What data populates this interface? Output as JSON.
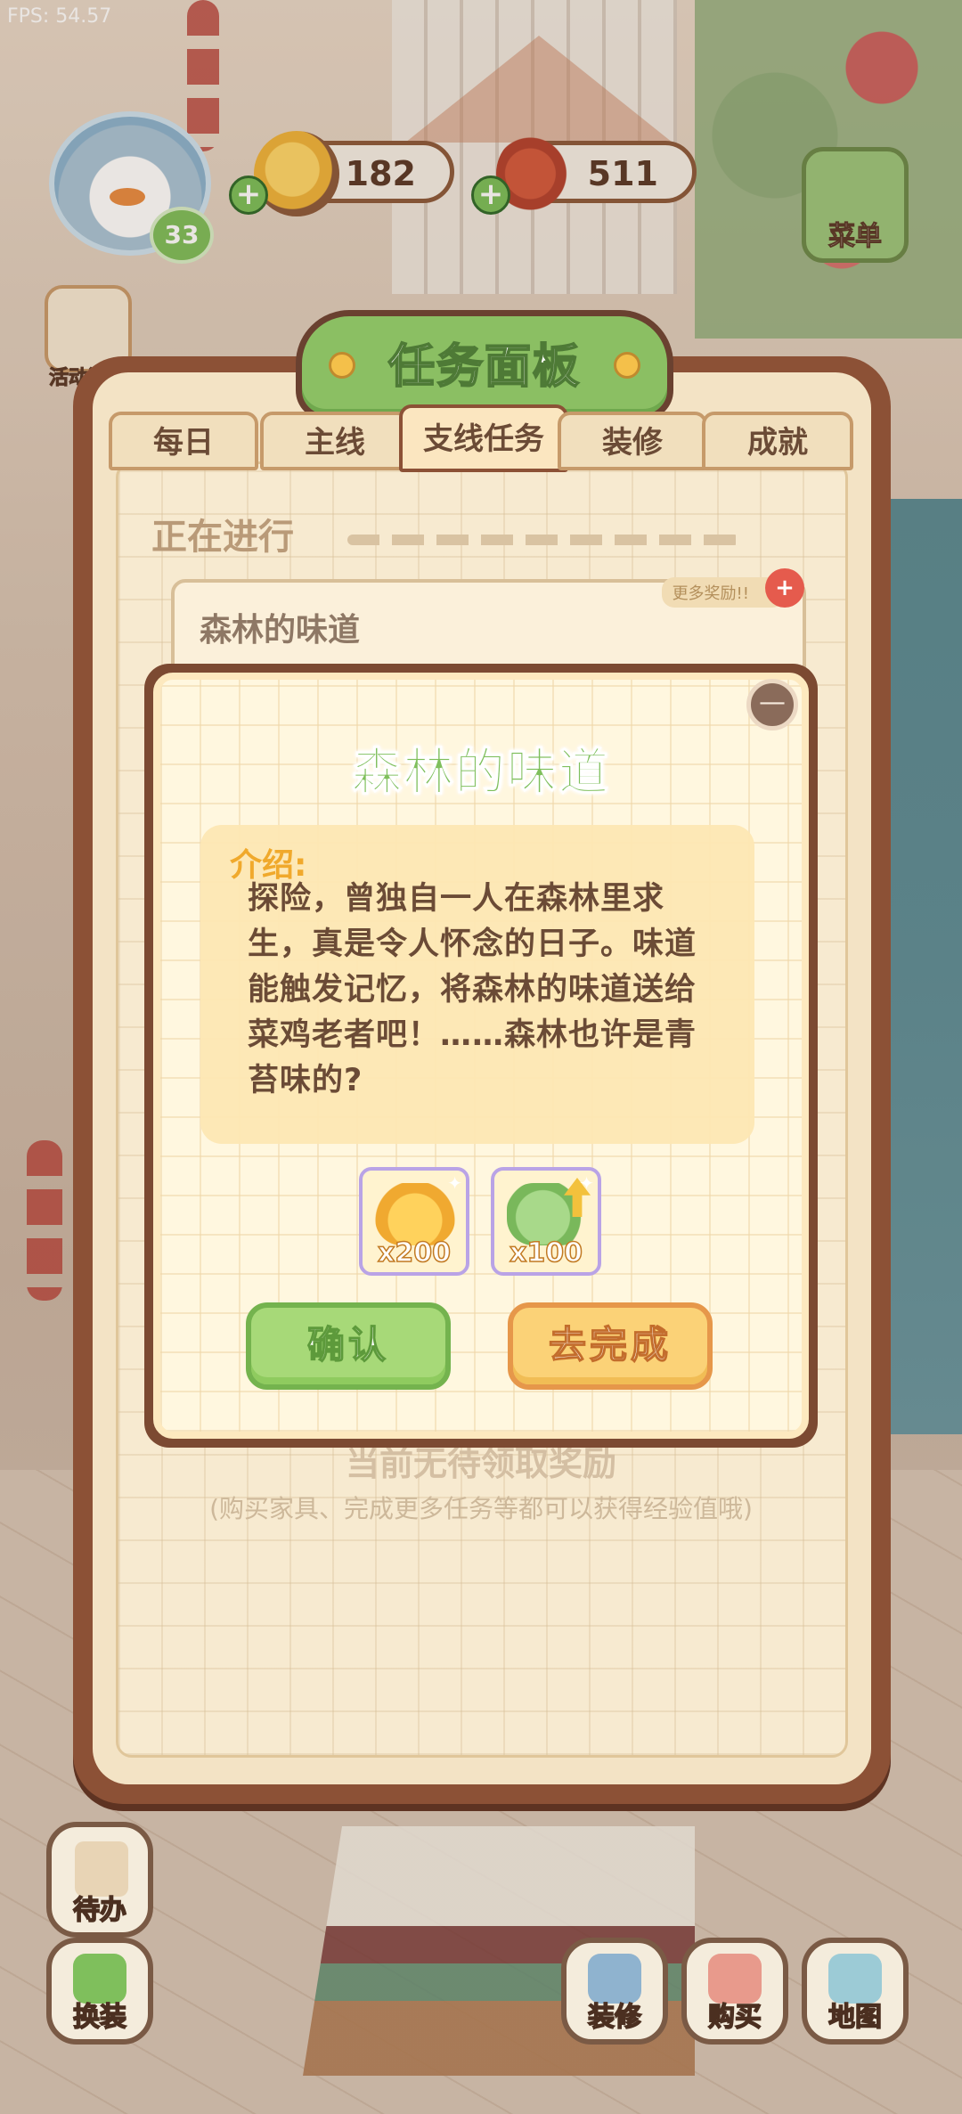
{
  "hud": {
    "fps": "FPS: 54.57",
    "level": "33",
    "coins": "182",
    "food": "511",
    "menu_label": "菜单",
    "left_buttons": [
      "活动汇总"
    ]
  },
  "panel": {
    "title": "任务面板",
    "tabs": [
      "每日",
      "主线",
      "支线任务",
      "装修",
      "成就"
    ],
    "active_tab": "支线任务",
    "in_progress_label": "正在进行",
    "task_name": "森林的味道",
    "more_rewards": "更多奖励!!",
    "no_reward_text": "当前无待领取奖励",
    "hint_text": "(购买家具、完成更多任务等都可以获得经验值哦)"
  },
  "modal": {
    "title": "森林的味道",
    "intro_label": "介绍:",
    "description": "探险，曾独自一人在森林里求生，真是令人怀念的日子。味道能触发记忆，将森林的味道送给菜鸡老者吧！……森林也许是青苔味的?",
    "rewards": [
      {
        "icon": "gold-coins-icon",
        "quantity": "x200"
      },
      {
        "icon": "moss-exp-icon",
        "quantity": "x100"
      }
    ],
    "confirm_label": "确认",
    "go_complete_label": "去完成"
  },
  "dock": {
    "todo": "待办",
    "dress": "换装",
    "decorate": "装修",
    "buy": "购买",
    "map": "地图"
  },
  "colors": {
    "panel_brown": "#8c5136",
    "title_green": "#8bbf63",
    "confirm_green": "#a7d978",
    "go_orange": "#fbd277",
    "intro_orange": "#f0a92c"
  }
}
